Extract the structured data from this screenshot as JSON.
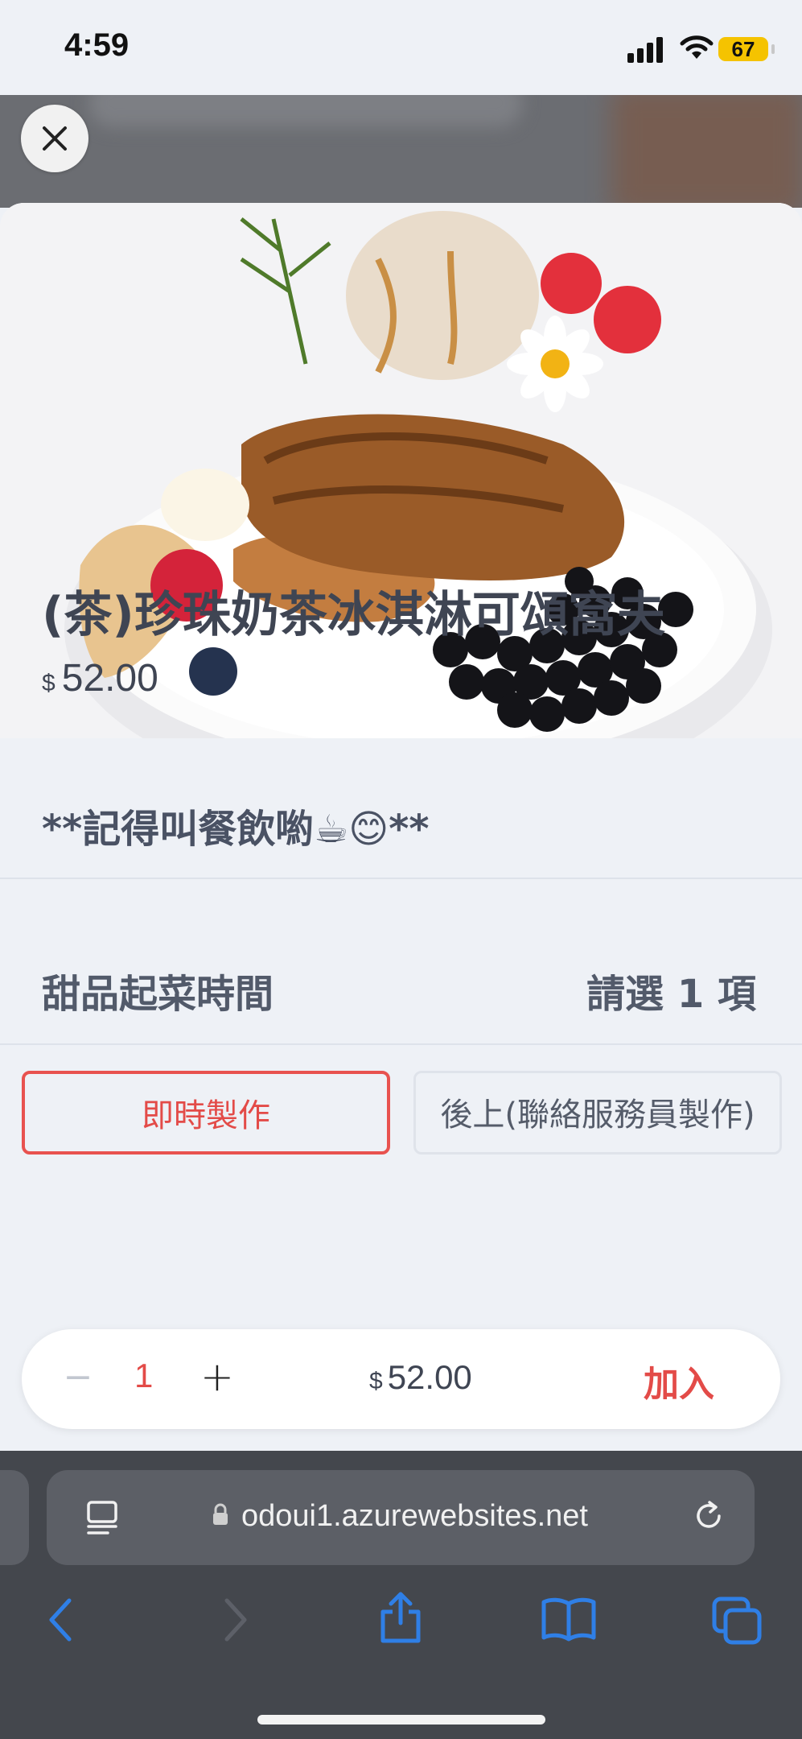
{
  "status_bar": {
    "time": "4:59",
    "battery": "67"
  },
  "product": {
    "title": "(茶)珍珠奶茶冰淇淋可頌窩夫",
    "currency": "$",
    "price": "52.00",
    "note": "**記得叫餐飲喲☕😊**"
  },
  "options_group": {
    "title": "甜品起菜時間",
    "requirement": "請選 1 項",
    "options": [
      {
        "label": "即時製作",
        "selected": true
      },
      {
        "label": "後上(聯絡服務員製作)",
        "selected": false
      }
    ]
  },
  "cart_bar": {
    "minus": "−",
    "quantity": "1",
    "plus": "+",
    "currency": "$",
    "total": "52.00",
    "add_label": "加入"
  },
  "browser": {
    "url": "odoui1.azurewebsites.net"
  },
  "colors": {
    "accent": "#e34b48",
    "text": "#3f4553",
    "ios_blue": "#2f7fe6"
  }
}
